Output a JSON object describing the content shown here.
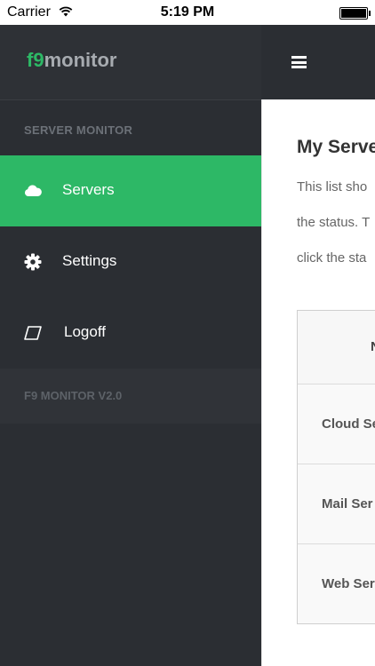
{
  "status_bar": {
    "carrier": "Carrier",
    "time": "5:19 PM"
  },
  "brand": {
    "logo_accent": "f9",
    "logo_rest": "monitor"
  },
  "sidebar": {
    "section_title": "SERVER MONITOR",
    "items": [
      {
        "label": "Servers",
        "icon": "cloud-icon",
        "active": true
      },
      {
        "label": "Settings",
        "icon": "gear-icon",
        "active": false
      },
      {
        "label": "Logoff",
        "icon": "logoff-icon",
        "active": false
      }
    ],
    "version": "F9 MONITOR V2.0"
  },
  "main": {
    "title": "My Serve",
    "lines": [
      "This list sho",
      "the status. T",
      "click the sta"
    ],
    "table": {
      "header": "N",
      "rows": [
        "Cloud Se",
        "Mail Ser",
        "Web Ser"
      ]
    }
  },
  "colors": {
    "accent": "#2db866",
    "sidebar_bg": "#2b2e33"
  }
}
